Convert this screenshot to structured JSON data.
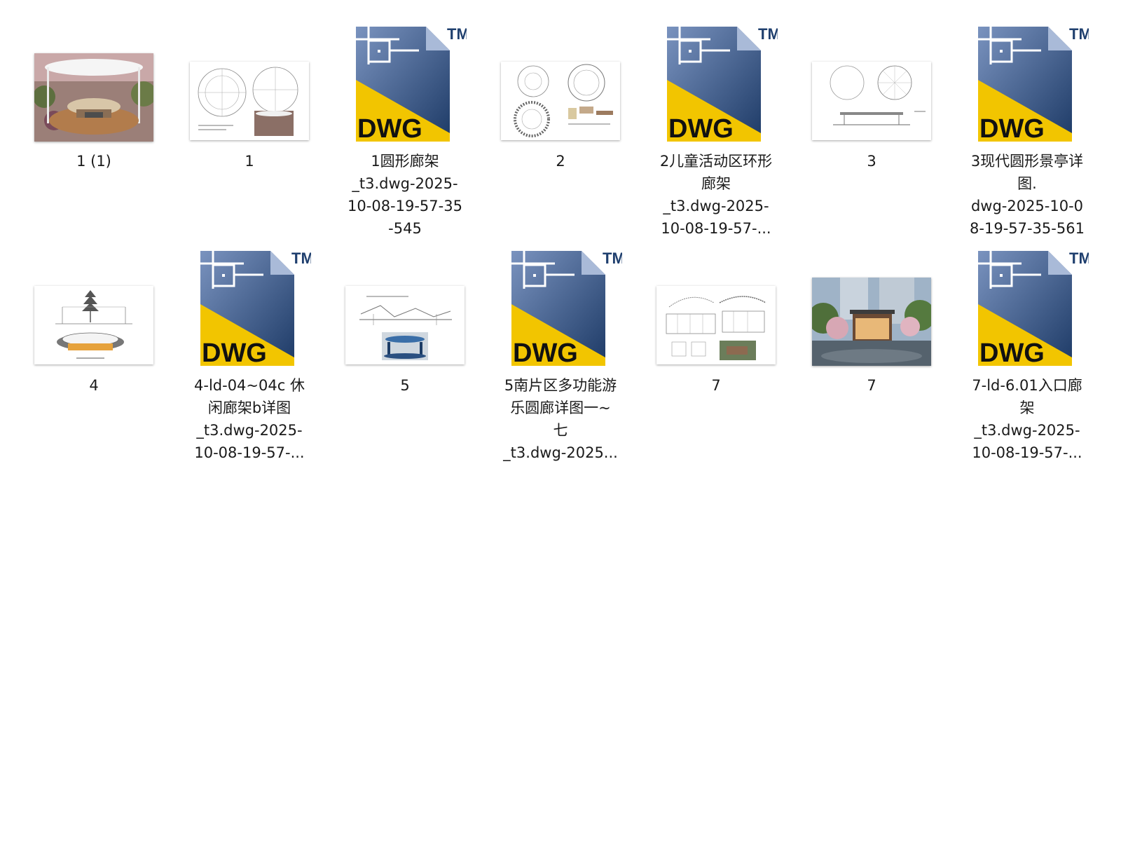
{
  "files": [
    {
      "label": "1 (1)",
      "type": "photo-pavilion"
    },
    {
      "label": "1",
      "type": "drawing-circles"
    },
    {
      "label": "1圆形廊架\n_t3.dwg-2025-\n10-08-19-57-35\n-545",
      "type": "dwg"
    },
    {
      "label": "2",
      "type": "drawing-ring"
    },
    {
      "label": "2儿童活动区环形\n廊架\n_t3.dwg-2025-\n10-08-19-57-...",
      "type": "dwg"
    },
    {
      "label": "3",
      "type": "drawing-plan"
    },
    {
      "label": "3现代圆形景亭详\n图.\ndwg-2025-10-0\n8-19-57-35-561",
      "type": "dwg"
    },
    {
      "label": "4",
      "type": "drawing-tree"
    },
    {
      "label": "4-ld-04~04c 休\n闲廊架b详图\n_t3.dwg-2025-\n10-08-19-57-...",
      "type": "dwg"
    },
    {
      "label": "5",
      "type": "drawing-section"
    },
    {
      "label": "5南片区多功能游\n乐圆廊详图一~\n七\n_t3.dwg-2025...",
      "type": "dwg"
    },
    {
      "label": "7",
      "type": "drawing-elevation"
    },
    {
      "label": "7",
      "type": "photo-entrance"
    },
    {
      "label": "7-ld-6.01入口廊\n架\n_t3.dwg-2025-\n10-08-19-57-...",
      "type": "dwg"
    }
  ],
  "dwg_icon": {
    "text": "DWG",
    "tm": "TM"
  },
  "colors": {
    "dwg_blue_dark": "#1f3f6e",
    "dwg_blue_light": "#6f88b3",
    "dwg_yellow": "#f2c500",
    "background": "#ffffff"
  }
}
